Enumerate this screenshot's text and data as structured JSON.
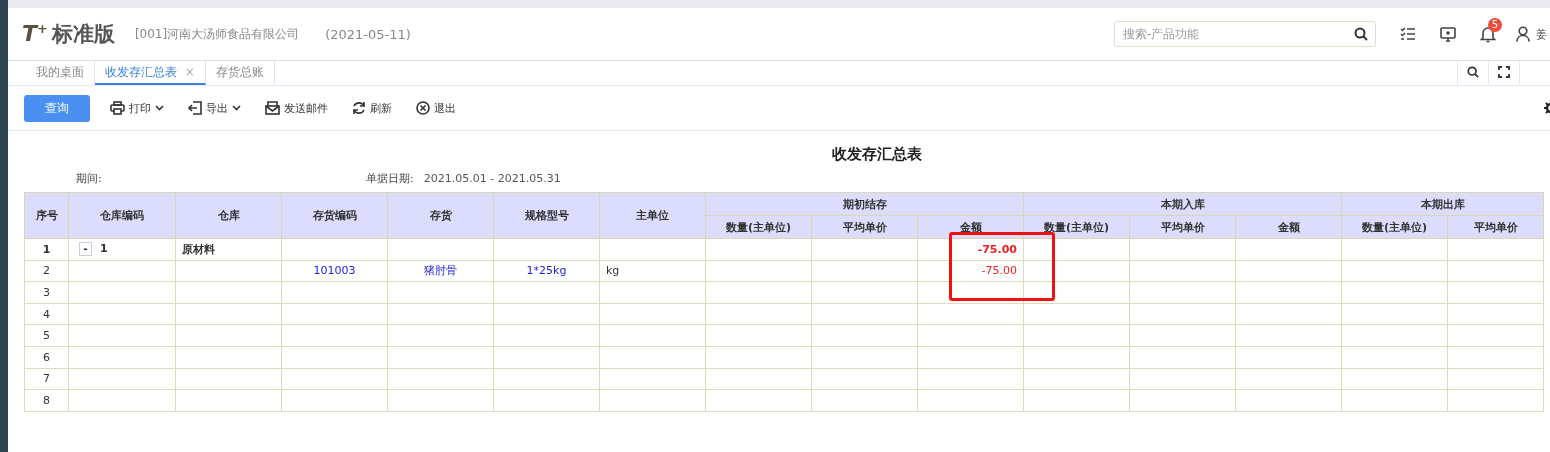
{
  "header": {
    "logo": "T$^{+}$",
    "edition": "标准版",
    "company": "[001]河南大汤师食品有限公司",
    "date": "(2021-05-11)",
    "search": {
      "placeholder": "搜索-产品功能"
    },
    "notification_count": "5",
    "user": "姜"
  },
  "tabs": [
    {
      "label": "我的桌面",
      "selected": false
    },
    {
      "label": "收发存汇总表",
      "selected": true,
      "close": "×"
    },
    {
      "label": "存货总账",
      "selected": false
    }
  ],
  "toolbar": {
    "primary": "查询",
    "items": [
      {
        "kind": "printer",
        "label": "打印",
        "dropdown": true
      },
      {
        "kind": "export",
        "label": "导出",
        "dropdown": true
      },
      {
        "kind": "mail",
        "label": "发送邮件",
        "dropdown": false
      },
      {
        "kind": "refresh",
        "label": "刷新",
        "dropdown": false
      },
      {
        "kind": "exit",
        "label": "退出",
        "dropdown": false
      }
    ]
  },
  "report": {
    "title": "收发存汇总表",
    "period_label": "期间:",
    "date_label": "单据日期:",
    "date_range": "2021.05.01 - 2021.05.31",
    "table": {
      "columns": [
        "序号",
        "仓库编码",
        "仓库",
        "存货编码",
        "存货",
        "规格型号",
        "主单位"
      ],
      "groups": [
        {
          "label": "期初结存",
          "columns": [
            "数量(主单位)",
            "平均单价",
            "金额"
          ]
        },
        {
          "label": "本期入库",
          "columns": [
            "数量(主单位)",
            "平均单价",
            "金额"
          ]
        },
        {
          "label": "本期出库",
          "columns": [
            "数量(主单位)",
            "平均单价"
          ]
        }
      ],
      "rows": [
        {
          "kind": "group",
          "toggle": "-",
          "cells": [
            "1",
            "1",
            "原材料",
            "",
            "",
            "",
            "",
            "",
            "",
            {
              "text": "-75.00",
              "kind": "negative"
            }
          ]
        },
        {
          "kind": "item",
          "cells": [
            "2",
            "",
            "",
            {
              "text": "101003",
              "kind": "link"
            },
            {
              "text": "猪肘骨",
              "kind": "link"
            },
            {
              "text": "1*25kg",
              "kind": "link"
            },
            "kg",
            "",
            "",
            {
              "text": "-75.00",
              "kind": "negative"
            }
          ]
        },
        {
          "kind": "item",
          "cells": [
            "3"
          ]
        },
        {
          "kind": "item",
          "cells": [
            "4"
          ]
        },
        {
          "kind": "item",
          "cells": [
            "5"
          ]
        },
        {
          "kind": "item",
          "cells": [
            "6"
          ]
        },
        {
          "kind": "item",
          "cells": [
            "7"
          ]
        },
        {
          "kind": "item",
          "cells": [
            "8"
          ]
        }
      ]
    }
  }
}
